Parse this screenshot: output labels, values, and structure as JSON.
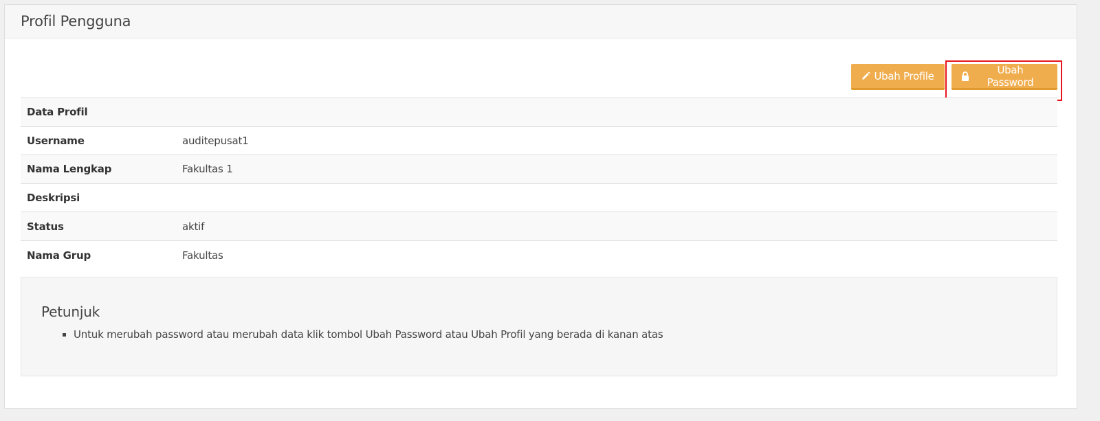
{
  "panel": {
    "title": "Profil Pengguna"
  },
  "toolbar": {
    "edit_profile_label": "Ubah Profile",
    "edit_profile_icon": "pencil-icon",
    "change_password_label": "Ubah Password",
    "change_password_icon": "lock-icon",
    "button_color": "#f0ad4e",
    "highlight_color": "#e8141c"
  },
  "profile": {
    "section_header": "Data Profil",
    "rows": [
      {
        "label": "Username",
        "value": "auditepusat1"
      },
      {
        "label": "Nama Lengkap",
        "value": "Fakultas 1"
      },
      {
        "label": "Deskripsi",
        "value": ""
      },
      {
        "label": "Status",
        "value": "aktif"
      },
      {
        "label": "Nama Grup",
        "value": "Fakultas"
      }
    ]
  },
  "hint": {
    "title": "Petunjuk",
    "items": [
      "Untuk merubah password atau merubah data klik tombol Ubah Password atau Ubah Profil yang berada di kanan atas"
    ]
  }
}
